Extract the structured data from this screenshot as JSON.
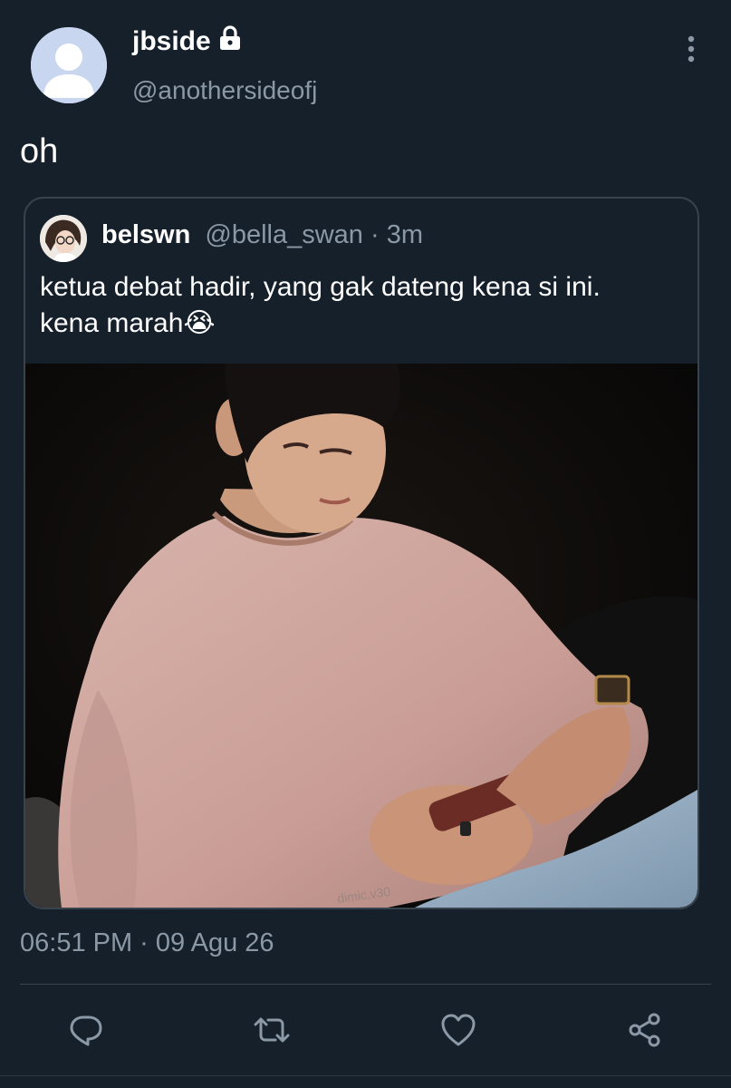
{
  "tweet": {
    "author": {
      "name": "jbside",
      "handle": "@anothersideofj",
      "protected_icon": "lock-icon",
      "avatar_icon": "default-avatar-icon"
    },
    "text": "oh",
    "timestamp": "06:51 PM · 09 Agu 26",
    "more_icon": "vertical-dots-icon"
  },
  "quoted_tweet": {
    "author_name": "belswn",
    "handle": "@bella_swan",
    "time_separator": " · ",
    "time": "3m",
    "text_line1": "ketua debat hadir, yang gak dateng kena si ini.",
    "text_line2": "kena marah",
    "emoji": "😭",
    "media_watermark": "dimic.v30"
  },
  "actions": {
    "reply_icon": "reply-icon",
    "retweet_icon": "retweet-icon",
    "like_icon": "heart-icon",
    "share_icon": "share-icon"
  },
  "colors": {
    "background": "#15202b",
    "secondary_text": "#8b98a5",
    "border": "#38444d"
  }
}
